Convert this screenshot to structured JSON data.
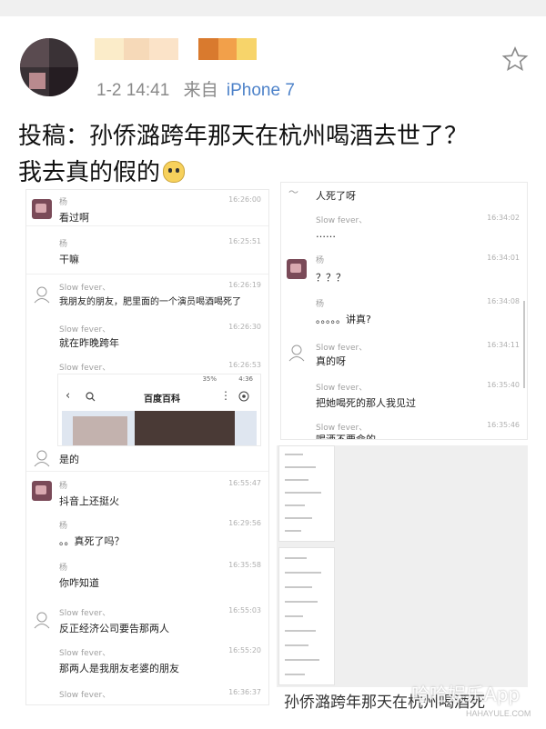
{
  "post": {
    "time": "1-2 14:41",
    "source_prefix": "来自",
    "device": "iPhone 7",
    "text_line1": "投稿：孙侨潞跨年那天在杭州喝酒去世了？",
    "text_line2": "我去真的假的"
  },
  "left_chat": {
    "messages": [
      {
        "sender": "杨",
        "time": "16:26:00",
        "text": "看过啊"
      },
      {
        "sender": "杨",
        "time": "16:25:51",
        "text": "干嘛"
      },
      {
        "sender": "Slow fever、",
        "time": "16:26:19",
        "text": "我朋友的朋友，肥里面的一个演员喝酒喝死了"
      },
      {
        "sender": "Slow fever、",
        "time": "16:26:30",
        "text": "就在昨晚跨年"
      },
      {
        "sender": "Slow fever、",
        "time": "16:26:53",
        "text": ""
      }
    ],
    "phone_status": "35%",
    "phone_time": "4:36",
    "phone_title": "百度百科",
    "messages_after": [
      {
        "sender": "",
        "time": "",
        "text": "是的"
      },
      {
        "sender": "杨",
        "time": "16:55:47",
        "text": "抖音上还挺火"
      },
      {
        "sender": "杨",
        "time": "16:29:56",
        "text": "。。真死了吗？"
      },
      {
        "sender": "杨",
        "time": "16:35:58",
        "text": "你咋知道"
      },
      {
        "sender": "Slow fever、",
        "time": "16:55:03",
        "text": "反正经济公司要告那两人"
      },
      {
        "sender": "Slow fever、",
        "time": "16:55:20",
        "text": "那两人是我朋友老婆的朋友"
      },
      {
        "sender": "Slow fever、",
        "time": "16:36:37",
        "text": ""
      }
    ]
  },
  "right_chat": {
    "messages": [
      {
        "sender": "",
        "time": "",
        "text": "人死了呀"
      },
      {
        "sender": "Slow fever、",
        "time": "16:34:02",
        "text": "……"
      },
      {
        "sender": "杨",
        "time": "16:34:01",
        "text": "？？？"
      },
      {
        "sender": "杨",
        "time": "16:34:08",
        "text": "。。。。。讲真?"
      },
      {
        "sender": "Slow fever、",
        "time": "16:34:11",
        "text": "真的呀"
      },
      {
        "sender": "Slow fever、",
        "time": "16:35:40",
        "text": "把她喝死的那人我见过"
      },
      {
        "sender": "Slow fever、",
        "time": "16:35:46",
        "text": "喝酒不要命的"
      }
    ]
  },
  "bottom_caption": "孙侨潞跨年那天在杭州喝酒死",
  "watermark": "哈哈娱乐App",
  "watermark_small": "HAHAYULE.COM"
}
